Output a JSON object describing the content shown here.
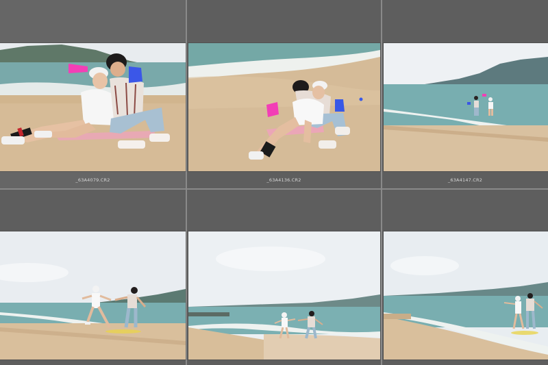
{
  "filmstrip": {
    "cells": [
      {
        "filename": "_63A4079.CR2"
      },
      {
        "filename": "_63A4136.CR2"
      },
      {
        "filename": "_63A4147.CR2"
      },
      {
        "filename": ""
      },
      {
        "filename": ""
      },
      {
        "filename": ""
      }
    ]
  },
  "colors": {
    "panel_bg": "#5e5e5e",
    "grid_gap": "#8a8a8a",
    "filename_text": "#d8d8d8",
    "sand": "#d9bf9c",
    "sea": "#6fa8a8",
    "sky": "#e9eef2"
  }
}
